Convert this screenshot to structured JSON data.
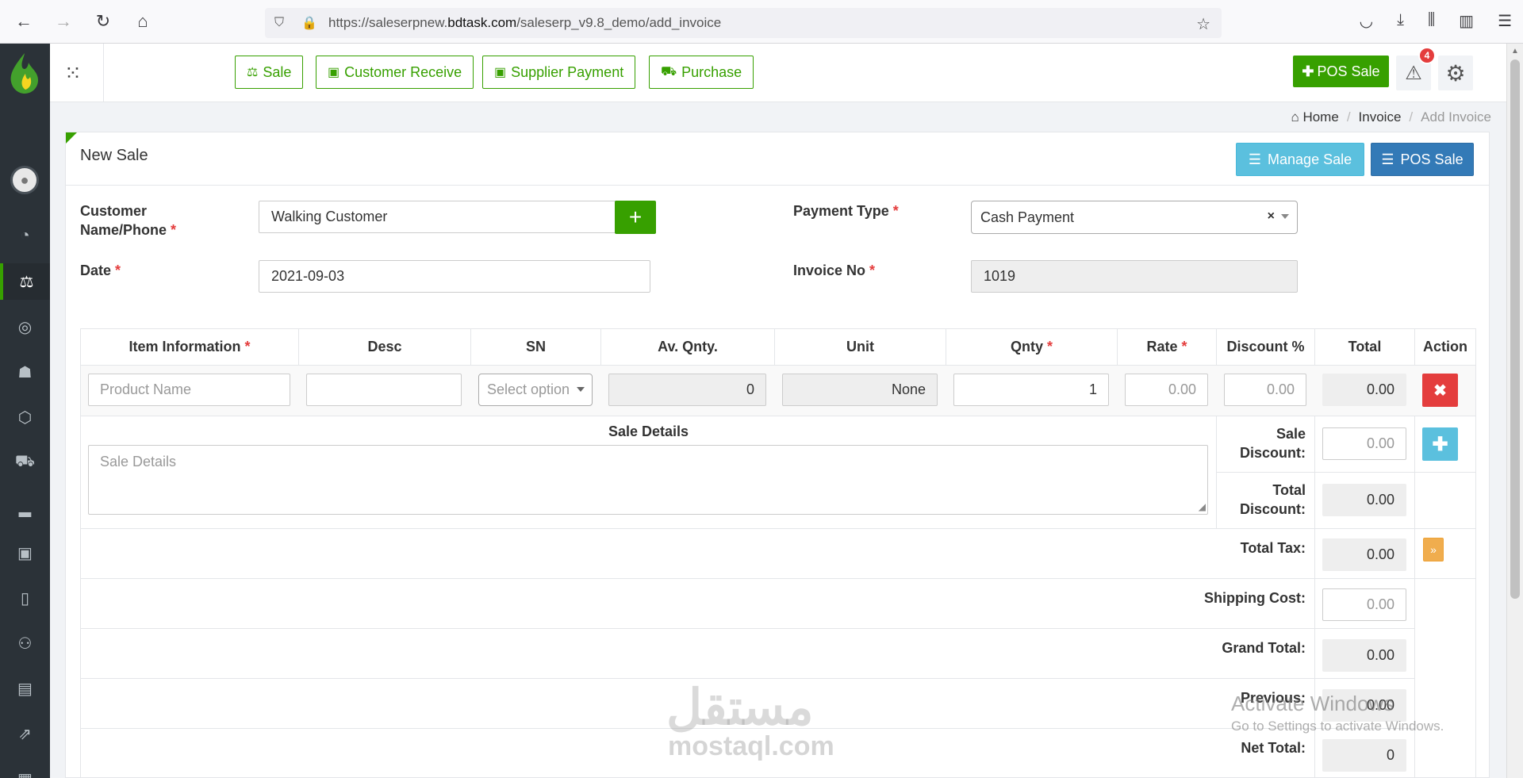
{
  "browser": {
    "url_prefix": "https://saleserpnew.",
    "url_domain": "bdtask.com",
    "url_suffix": "/saleserp_v9.8_demo/add_invoice"
  },
  "topbar": {
    "quick_buttons": [
      "Sale",
      "Customer Receive",
      "Supplier Payment",
      "Purchase"
    ],
    "pos_sale": "POS Sale",
    "alert_count": "4"
  },
  "breadcrumb": {
    "home": "Home",
    "section": "Invoice",
    "current": "Add Invoice"
  },
  "panel": {
    "title": "New Sale",
    "manage_sale": "Manage Sale",
    "pos_sale": "POS Sale"
  },
  "form": {
    "customer_label_1": "Customer",
    "customer_label_2": "Name/Phone",
    "customer_value": "Walking Customer",
    "date_label": "Date",
    "date_value": "2021-09-03",
    "payment_type_label": "Payment Type",
    "payment_type_value": "Cash Payment",
    "invoice_no_label": "Invoice No",
    "invoice_no_value": "1019",
    "required_mark": "*",
    "add_icon": "+",
    "clear_icon": "×"
  },
  "table": {
    "headers": {
      "item": "Item Information",
      "desc": "Desc",
      "sn": "SN",
      "av_qnty": "Av. Qnty.",
      "unit": "Unit",
      "qnty": "Qnty",
      "rate": "Rate",
      "discount": "Discount %",
      "total": "Total",
      "action": "Action"
    },
    "row": {
      "product_placeholder": "Product Name",
      "sn_placeholder": "Select option",
      "av_qnty": "0",
      "unit": "None",
      "qnty": "1",
      "rate_placeholder": "0.00",
      "discount_placeholder": "0.00",
      "total": "0.00"
    },
    "sale_details_label": "Sale Details",
    "sale_details_placeholder": "Sale Details",
    "summary": {
      "sale_discount_1": "Sale",
      "sale_discount_2": "Discount:",
      "sale_discount_placeholder": "0.00",
      "total_discount_1": "Total",
      "total_discount_2": "Discount:",
      "total_discount": "0.00",
      "total_tax_label": "Total Tax:",
      "total_tax": "0.00",
      "shipping_label": "Shipping Cost:",
      "shipping_placeholder": "0.00",
      "grand_total_label": "Grand Total:",
      "grand_total": "0.00",
      "previous_label": "Previous:",
      "previous": "0.00",
      "net_total_label": "Net Total:",
      "net_total": "0"
    }
  },
  "watermark": {
    "activate_title": "Activate Windows",
    "activate_sub": "Go to Settings to activate Windows.",
    "mostaql_ar": "مستقل",
    "mostaql_en": "mostaql.com"
  },
  "colors": {
    "brand_green": "#37a000",
    "sidebar": "#2b3238",
    "info": "#5bc0de",
    "primary": "#337ab7",
    "danger": "#e43d3d",
    "warning": "#f0ad4e"
  }
}
